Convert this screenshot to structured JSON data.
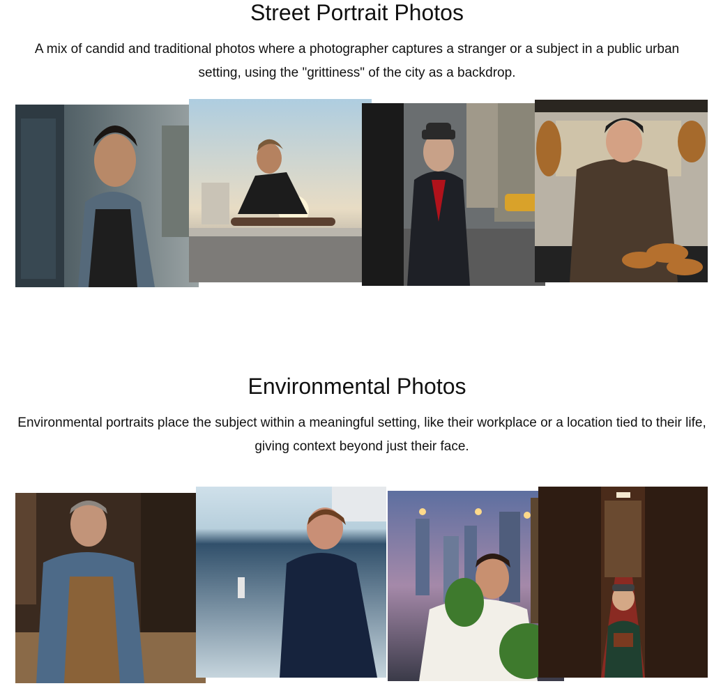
{
  "sections": [
    {
      "title": "Street Portrait Photos",
      "description": "A mix of candid and traditional photos where a photographer captures a stranger or a subject in a public urban setting, using the \"grittiness\" of the city as a backdrop.",
      "photos": [
        {
          "subject": "young man in denim jacket against brick wall"
        },
        {
          "subject": "skateboarder sitting on ledge at sunset"
        },
        {
          "subject": "elderly man in dark suit and fedora on city street"
        },
        {
          "subject": "smiling pretzel vendor at street cart"
        }
      ]
    },
    {
      "title": "Environmental Photos",
      "description": "Environmental portraits place the subject within a meaningful setting, like their workplace or a location tied to their life, giving context beyond just their face.",
      "photos": [
        {
          "subject": "carpenter in workshop wearing apron"
        },
        {
          "subject": "woman examining sample vial on ship deck by the sea"
        },
        {
          "subject": "chef smelling herbs on rooftop garden at dusk"
        },
        {
          "subject": "person holding book in long library aisle"
        }
      ]
    }
  ]
}
